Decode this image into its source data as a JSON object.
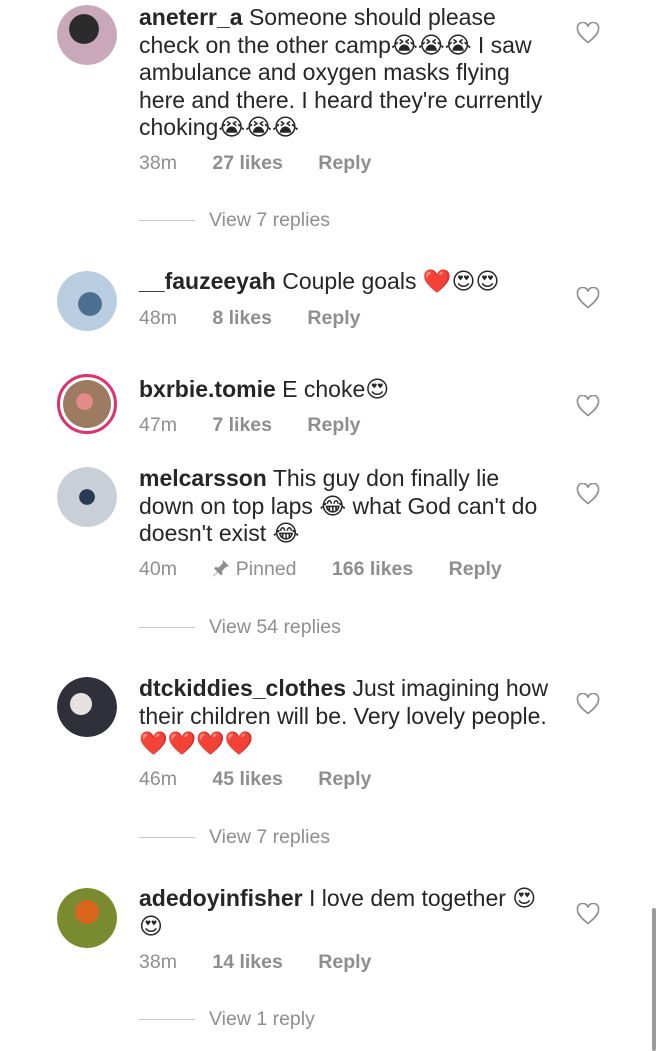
{
  "comments": [
    {
      "username": "aneterr_a",
      "text": "Someone should please check on the other camp😭😭😭 I saw ambulance and oxygen masks flying here and there. I heard they're currently choking😭😭😭",
      "time": "38m",
      "pinned": "",
      "likes": "27 likes",
      "reply": "Reply",
      "view_replies": "View 7 replies",
      "avatar_color": "#8d7a86"
    },
    {
      "username": "__fauzeeyah",
      "text": "Couple goals ❤️😍😍",
      "time": "48m",
      "pinned": "",
      "likes": "8 likes",
      "reply": "Reply",
      "view_replies": "",
      "avatar_color": "#a9c2d6"
    },
    {
      "username": "bxrbie.tomie",
      "text": "E choke😍",
      "time": "47m",
      "pinned": "",
      "likes": "7 likes",
      "reply": "Reply",
      "view_replies": "",
      "avatar_color": "#b98f6b"
    },
    {
      "username": "melcarsson",
      "text": "This guy don finally lie down on top laps 😂 what God can't do doesn't exist 😂",
      "time": "40m",
      "pinned": "Pinned",
      "likes": "166 likes",
      "reply": "Reply",
      "view_replies": "View 54 replies",
      "avatar_color": "#7f8fa3"
    },
    {
      "username": "dtckiddies_clothes",
      "text": "Just imagining how their children will be. Very lovely people. ❤️❤️❤️❤️",
      "time": "46m",
      "pinned": "",
      "likes": "45 likes",
      "reply": "Reply",
      "view_replies": "View 7 replies",
      "avatar_color": "#3b3b45"
    },
    {
      "username": "adedoyinfisher",
      "text": "I love dem together 😍😍",
      "time": "38m",
      "pinned": "",
      "likes": "14 likes",
      "reply": "Reply",
      "view_replies": "View 1 reply",
      "avatar_color": "#8a7a2f"
    }
  ]
}
